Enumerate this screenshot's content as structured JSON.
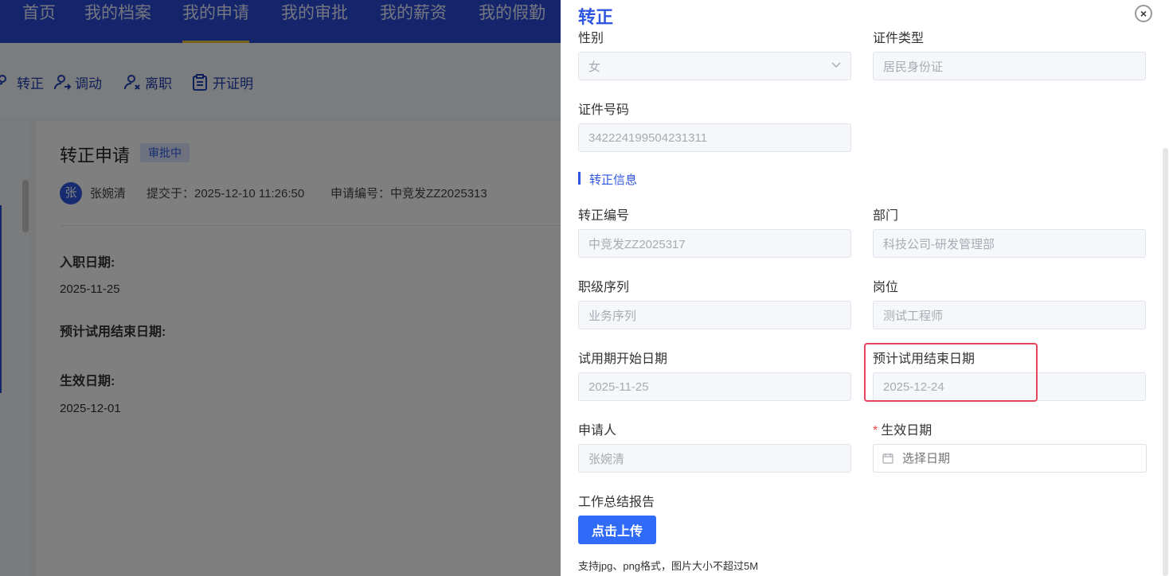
{
  "topnav": {
    "items": [
      "首页",
      "我的档案",
      "我的申请",
      "我的审批",
      "我的薪资",
      "我的假勤"
    ],
    "active_index": 2
  },
  "actions": [
    "转正",
    "调动",
    "离职",
    "开证明"
  ],
  "card": {
    "title": "转正申请",
    "status_badge": "审批中",
    "avatar_char": "张",
    "applicant": "张婉清",
    "submitted": "提交于：2025-12-10 11:26:50",
    "app_no": "申请编号：中竞发ZZ2025313",
    "fields": [
      {
        "label": "入职日期:",
        "value": "2025-11-25"
      },
      {
        "label": "预计试用结束日期:",
        "value": ""
      },
      {
        "label": "生效日期:",
        "value": "2025-12-01"
      }
    ]
  },
  "drawer": {
    "title": "转正",
    "close_symbol": "×",
    "partial_labels": [
      "性别",
      "证件类型"
    ],
    "gender_value": "女",
    "id_type_value": "居民身份证",
    "id_number_label": "证件号码",
    "id_number_value": "342224199504231311",
    "section_title": "转正信息",
    "fields": [
      {
        "label": "转正编号",
        "value": "中竞发ZZ2025317"
      },
      {
        "label": "部门",
        "value": "科技公司-研发管理部"
      },
      {
        "label": "职级序列",
        "value": "业务序列"
      },
      {
        "label": "岗位",
        "value": "测试工程师"
      },
      {
        "label": "试用期开始日期",
        "value": "2025-11-25"
      },
      {
        "label": "预计试用结束日期",
        "value": "2025-12-24"
      },
      {
        "label": "申请人",
        "value": "张婉清"
      }
    ],
    "effective_date": {
      "required_mark": "*",
      "label": "生效日期",
      "placeholder": "选择日期"
    },
    "upload": {
      "label": "工作总结报告",
      "button": "点击上传",
      "hint": "支持jpg、png格式，图片大小不超过5M"
    }
  },
  "colors": {
    "primary": "#2f56e0",
    "nav": "#2b4bd8",
    "highlight": "#e8445a",
    "required": "#f04747"
  }
}
